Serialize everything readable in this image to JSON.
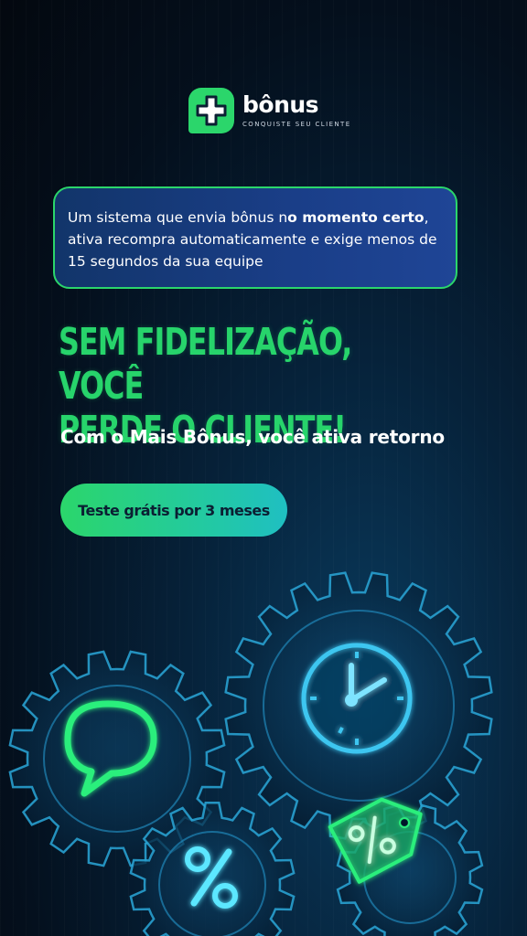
{
  "brand": {
    "name": "bônus",
    "tagline": "CONQUISTE SEU CLIENTE",
    "accent_color": "#2bd66b",
    "logo_icon": "plus-icon"
  },
  "info_box": {
    "part1": "Um sistema que envia bônus n",
    "bold1": "o momento certo",
    "part2": ", ativa recompra automaticamente e exige menos de 15 segundos da sua equipe"
  },
  "headline": {
    "line1": "SEM FIDELIZAÇÃO, VOCÊ",
    "line2": "PERDE O CLIENTE!"
  },
  "subheadline": "Com o Mais Bônus, você ativa retorno",
  "cta": {
    "label": "Teste grátis por 3 meses"
  },
  "illustration": {
    "icons": [
      "gear-icon",
      "chat-bubble-icon",
      "clock-icon",
      "percent-icon",
      "price-tag-icon"
    ]
  }
}
